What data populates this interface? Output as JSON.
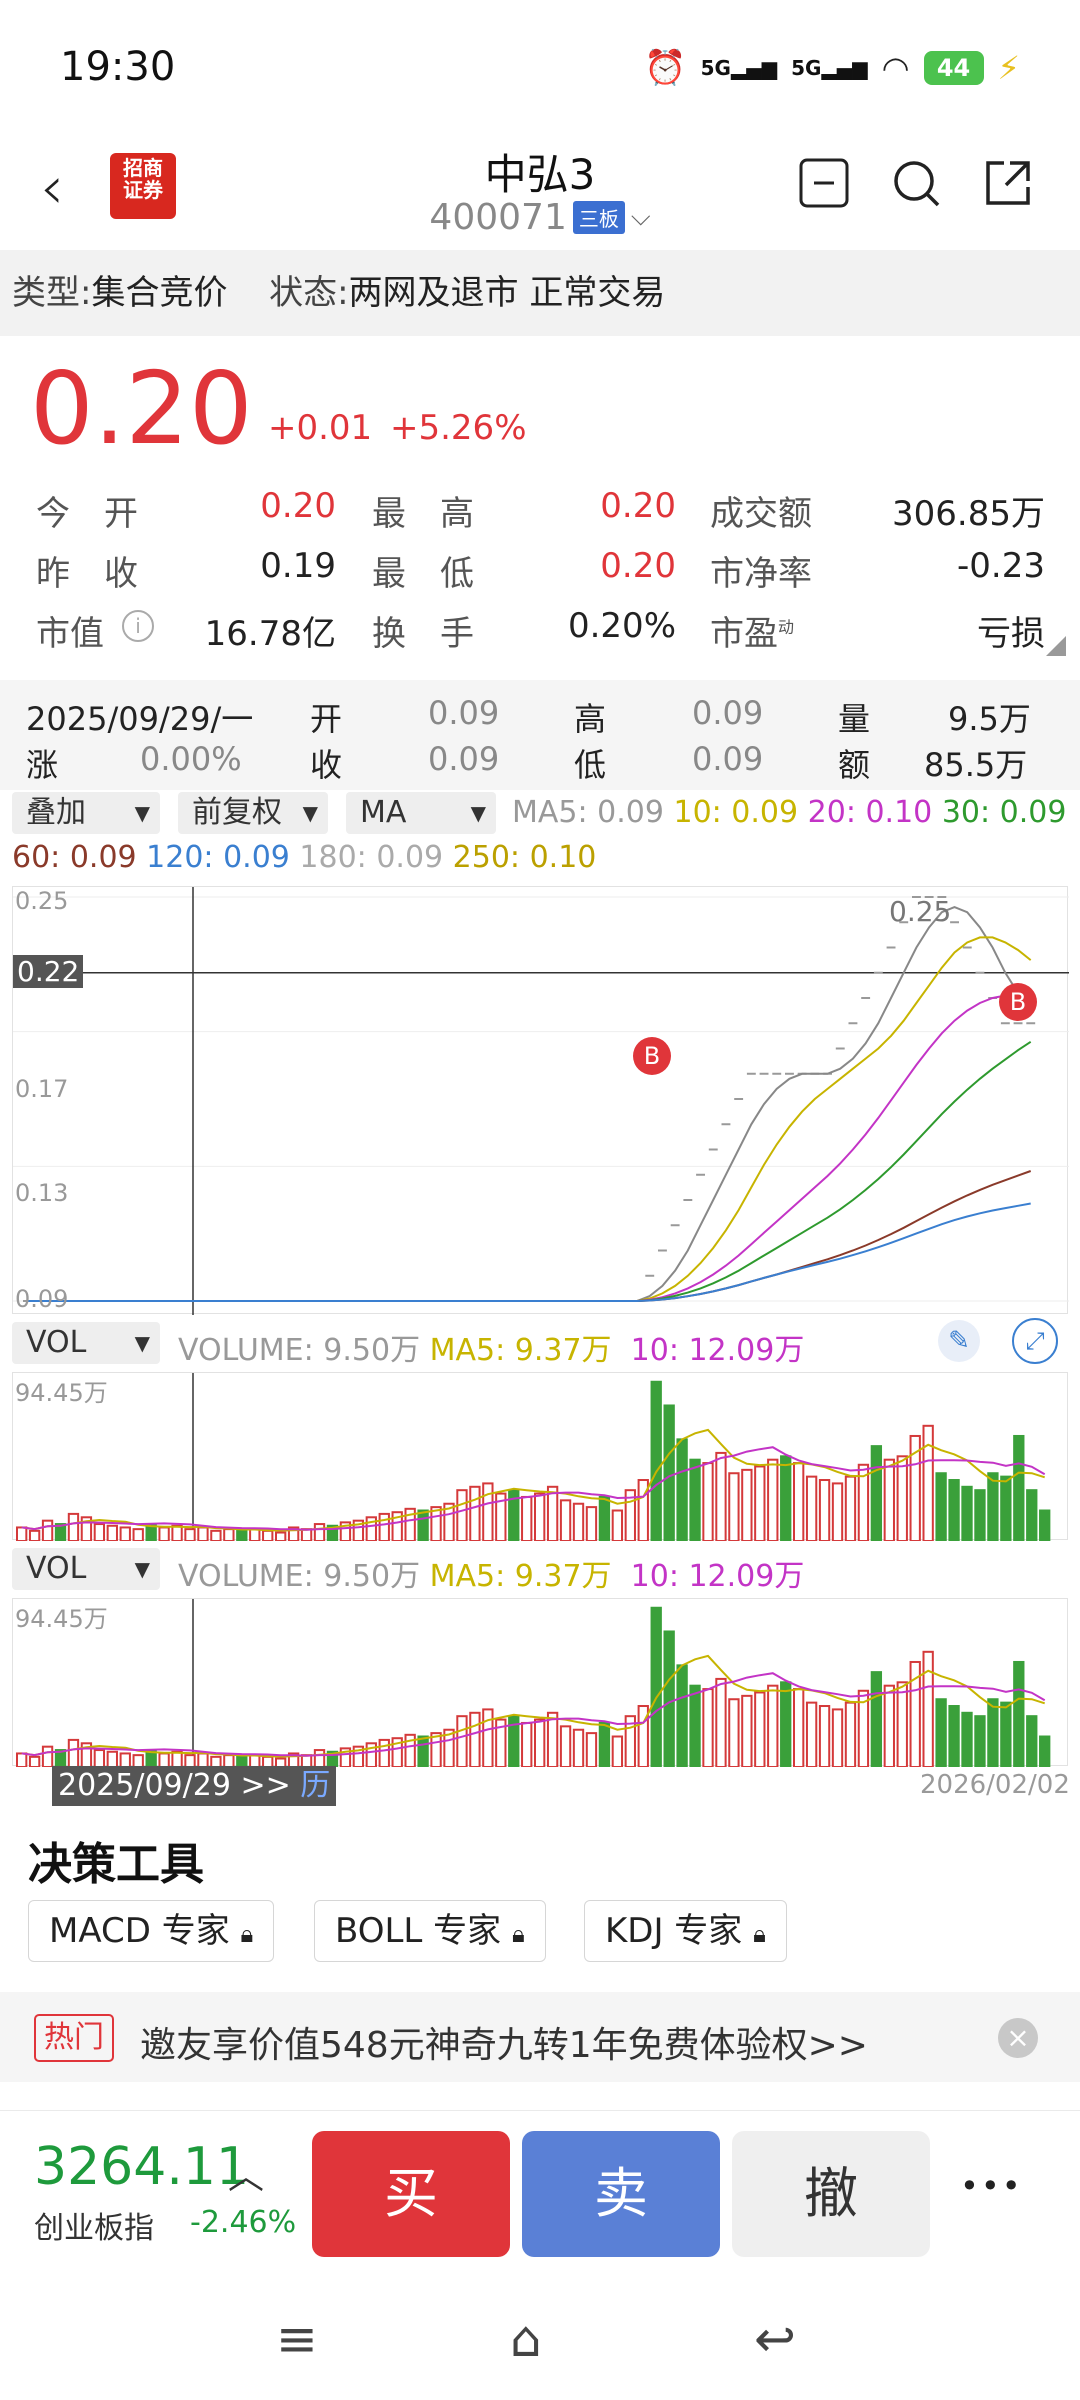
{
  "status": {
    "time": "19:30",
    "net1": "5G",
    "net2": "5G",
    "battery": "44"
  },
  "nav": {
    "back": "‹",
    "logo_line1": "招商",
    "logo_line2": "证券",
    "name": "中弘3",
    "code": "400071",
    "board": "三板"
  },
  "type_bar": {
    "type_label": "类型:",
    "type_value": "集合竞价",
    "status_label": "状态:",
    "status_value": "两网及退市 正常交易"
  },
  "price": {
    "last": "0.20",
    "change": "+0.01",
    "pct": "+5.26%"
  },
  "quote": {
    "open_label": "今　开",
    "open": "0.20",
    "high_label": "最　高",
    "high": "0.20",
    "turnover_label": "成交额",
    "turnover": "306.85万",
    "prev_label": "昨　收",
    "prev": "0.19",
    "low_label": "最　低",
    "low": "0.20",
    "pb_label": "市净率",
    "pb": "-0.23",
    "mcap_label": "市值",
    "mcap": "16.78亿",
    "turnrate_label": "换　手",
    "turnrate": "0.20%",
    "pe_label": "市盈",
    "pe_sup": "动",
    "pe": "亏损"
  },
  "daybar": {
    "date": "2025/09/29/一",
    "open_l": "开",
    "open": "0.09",
    "high_l": "高",
    "high": "0.09",
    "vol_l": "量",
    "vol": "9.5万",
    "chg_l": "涨",
    "chg": "0.00%",
    "close_l": "收",
    "close": "0.09",
    "low_l": "低",
    "low": "0.09",
    "amt_l": "额",
    "amt": "85.5万"
  },
  "indicator_bar": {
    "overlay": "叠加",
    "adjust": "前复权",
    "ma": "MA",
    "ma5": "MA5: 0.09",
    "ma10": "10: 0.09",
    "ma20": "20: 0.10",
    "ma30": "30: 0.09",
    "ma60": "60: 0.09",
    "ma120": "120: 0.09",
    "ma180": "180: 0.09",
    "ma250": "250: 0.10"
  },
  "kline": {
    "y_top": "0.25",
    "y_mid": "0.17",
    "y_low": "0.13",
    "y_bottom": "0.09",
    "crosshair": "0.22",
    "peak": "0.25",
    "marker": "B"
  },
  "volume_panel": {
    "selector": "VOL",
    "vol": "VOLUME: 9.50万",
    "ma5": "MA5: 9.37万",
    "ma10": "10: 12.09万",
    "max": "94.45万"
  },
  "date_axis": {
    "start": "2025/09/29 >>",
    "hist": "历",
    "end": "2026/02/02"
  },
  "decision": {
    "title": "决策工具",
    "tools": [
      "MACD 专家",
      "BOLL 专家",
      "KDJ 专家"
    ]
  },
  "ad": {
    "tag": "热门",
    "text": "邀友享价值548元神奇九转1年免费体验权>>"
  },
  "bottom": {
    "index_value": "3264.11",
    "index_name": "创业板指",
    "index_change": "-2.46%",
    "buy": "买",
    "sell": "卖",
    "cancel": "撤",
    "more": "•••"
  },
  "chart_data": {
    "type": "candlestick",
    "ylim": [
      0.09,
      0.25
    ],
    "close": [
      0.09,
      0.09,
      0.09,
      0.09,
      0.09,
      0.09,
      0.09,
      0.09,
      0.09,
      0.09,
      0.09,
      0.09,
      0.09,
      0.09,
      0.09,
      0.09,
      0.09,
      0.09,
      0.09,
      0.09,
      0.09,
      0.09,
      0.09,
      0.09,
      0.09,
      0.09,
      0.09,
      0.09,
      0.09,
      0.09,
      0.09,
      0.09,
      0.09,
      0.09,
      0.09,
      0.09,
      0.09,
      0.09,
      0.09,
      0.09,
      0.09,
      0.09,
      0.09,
      0.09,
      0.09,
      0.09,
      0.09,
      0.09,
      0.09,
      0.1,
      0.11,
      0.12,
      0.13,
      0.14,
      0.15,
      0.16,
      0.17,
      0.18,
      0.18,
      0.18,
      0.18,
      0.18,
      0.18,
      0.18,
      0.19,
      0.2,
      0.21,
      0.22,
      0.23,
      0.24,
      0.25,
      0.25,
      0.25,
      0.24,
      0.23,
      0.22,
      0.21,
      0.2,
      0.2,
      0.2
    ],
    "volume": [
      8,
      6,
      12,
      10,
      16,
      14,
      10,
      9,
      8,
      7,
      10,
      8,
      9,
      7,
      8,
      6,
      7,
      6,
      7,
      6,
      5,
      8,
      7,
      10,
      9,
      11,
      12,
      14,
      16,
      17,
      19,
      18,
      20,
      22,
      30,
      32,
      34,
      28,
      30,
      26,
      28,
      32,
      24,
      22,
      20,
      26,
      18,
      30,
      36,
      94,
      80,
      60,
      48,
      46,
      52,
      40,
      42,
      44,
      48,
      50,
      46,
      38,
      36,
      34,
      38,
      45,
      56,
      48,
      50,
      62,
      68,
      40,
      36,
      32,
      30,
      40,
      38,
      62,
      30,
      18
    ]
  }
}
